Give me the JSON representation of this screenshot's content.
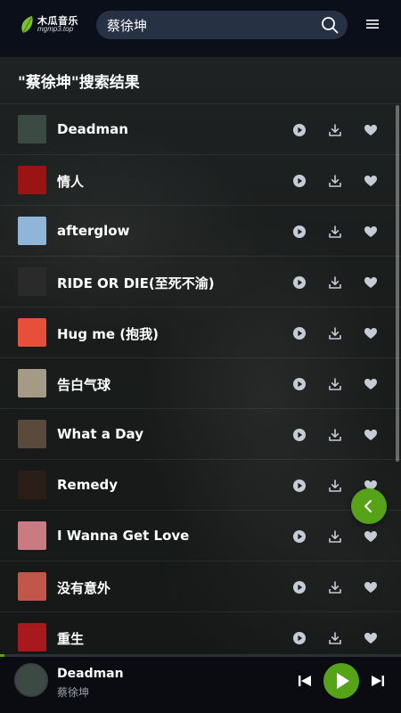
{
  "header": {
    "logo_name": "木瓜音乐",
    "logo_domain": "mgmp3.top",
    "search_value": "蔡徐坤",
    "search_placeholder": "",
    "search_icon": "search-icon",
    "menu_icon": "menu-icon"
  },
  "results": {
    "title": "\"蔡徐坤\"搜索结果",
    "songs": [
      {
        "title": "Deadman",
        "cover": "#3c4a44"
      },
      {
        "title": "情人",
        "cover": "#9b1414"
      },
      {
        "title": "afterglow",
        "cover": "#8fb5d8"
      },
      {
        "title": "RIDE OR DIE(至死不渝)",
        "cover": "#2a2a2a"
      },
      {
        "title": "Hug me (抱我)",
        "cover": "#e6503a"
      },
      {
        "title": "告白气球",
        "cover": "#a49a86"
      },
      {
        "title": "What a Day",
        "cover": "#5a4a3c"
      },
      {
        "title": "Remedy",
        "cover": "#2b1d17"
      },
      {
        "title": "I Wanna Get Love",
        "cover": "#c97b82"
      },
      {
        "title": "没有意外",
        "cover": "#c0574a"
      },
      {
        "title": "重生",
        "cover": "#a8191d"
      }
    ],
    "actions": {
      "play": "play-circle-icon",
      "download": "download-icon",
      "favorite": "heart-icon"
    }
  },
  "fab": {
    "icon": "chevron-left-icon"
  },
  "player": {
    "title": "Deadman",
    "artist": "蔡徐坤",
    "progress": 0.01,
    "accent": "#57a318",
    "prev_icon": "skip-previous-icon",
    "play_icon": "play-icon",
    "next_icon": "skip-next-icon"
  }
}
